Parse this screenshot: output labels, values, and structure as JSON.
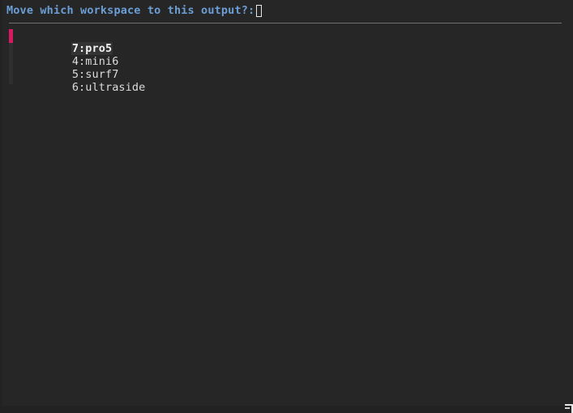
{
  "window": {
    "app": "rofi-workspace-mover",
    "background_color": "#262626",
    "border_color": "#222222"
  },
  "prompt": {
    "label": "Move which workspace to this output?:",
    "label_color": "#6b9ed6",
    "input_value": "",
    "input_placeholder": "",
    "cursor_style": "hollow-block",
    "cursor_color": "#e8e8e8"
  },
  "separator": {
    "color": "#6f6f6f"
  },
  "scrollbar": {
    "thumb_color": "#d8185f",
    "track_color": "#2e2e2e",
    "position": "left"
  },
  "list": {
    "selected_index": 0,
    "selected_bg": "#333333",
    "text_color": "#dcdcdc",
    "items": [
      {
        "label": "7:pro5"
      },
      {
        "label": "4:mini6"
      },
      {
        "label": "5:surf7"
      },
      {
        "label": "6:ultraside"
      }
    ]
  },
  "resize_grip": {
    "name": "resize-grip",
    "color": "#e6e6e6"
  }
}
